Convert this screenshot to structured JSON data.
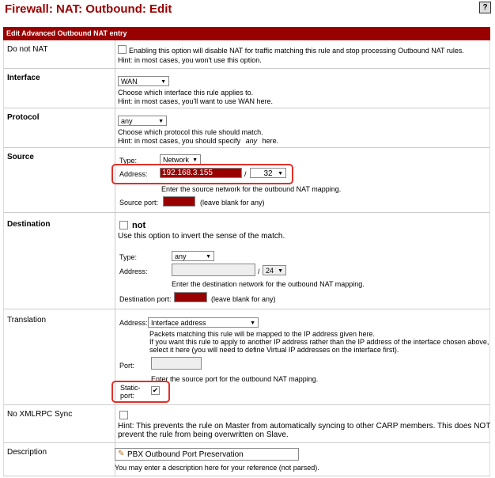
{
  "page": {
    "title": "Firewall: NAT: Outbound: Edit",
    "help_icon": "?"
  },
  "section": {
    "title": "Edit Advanced Outbound NAT entry"
  },
  "do_not_nat": {
    "label": "Do not NAT",
    "text": "Enabling this option will disable NAT for traffic matching this rule and stop processing Outbound NAT rules.",
    "hint": "Hint: in most cases, you won't use this option."
  },
  "interface": {
    "label": "Interface",
    "value": "WAN",
    "help1": "Choose which interface this rule applies to.",
    "help2": "Hint: in most cases, you'll want to use WAN here."
  },
  "protocol": {
    "label": "Protocol",
    "value": "any",
    "help1": "Choose which protocol this rule should match.",
    "help2_pre": "Hint: in most cases, you should specify",
    "help2_em": "any",
    "help2_post": "here."
  },
  "source": {
    "label": "Source",
    "type_label": "Type:",
    "type_value": "Network",
    "address_label": "Address:",
    "address_value": "192.168.3.155",
    "slash": "/",
    "mask": "32",
    "help": "Enter the source network for the outbound NAT mapping.",
    "port_label": "Source port:",
    "port_hint": "(leave blank for any)"
  },
  "destination": {
    "label": "Destination",
    "not_label": "not",
    "invert_text": "Use this option to invert the sense of the match.",
    "type_label": "Type:",
    "type_value": "any",
    "address_label": "Address:",
    "slash": "/",
    "mask": "24",
    "help": "Enter the destination network for the outbound NAT mapping.",
    "port_label": "Destination port:",
    "port_hint": "(leave blank for any)"
  },
  "translation": {
    "label": "Translation",
    "address_label": "Address:",
    "address_value": "Interface address",
    "help1": "Packets matching this rule will be mapped to the IP address given here.",
    "help2": "If you want this rule to apply to another IP address rather than the IP address of the interface chosen above,",
    "help3": "select it here (you will need to define Virtual IP addresses on the interface first).",
    "port_label": "Port:",
    "port_help": "Enter the source port for the outbound NAT mapping.",
    "static_label1": "Static-",
    "static_label2": "port:",
    "static_checked": true
  },
  "xmlrpc": {
    "label": "No XMLRPC Sync",
    "help1": "Hint: This prevents the rule on Master from automatically syncing to other CARP members. This does NOT",
    "help2": "prevent the rule from being overwritten on Slave."
  },
  "description": {
    "label": "Description",
    "value": "PBX Outbound Port Preservation",
    "help": "You may enter a description here for your reference (not parsed)."
  }
}
